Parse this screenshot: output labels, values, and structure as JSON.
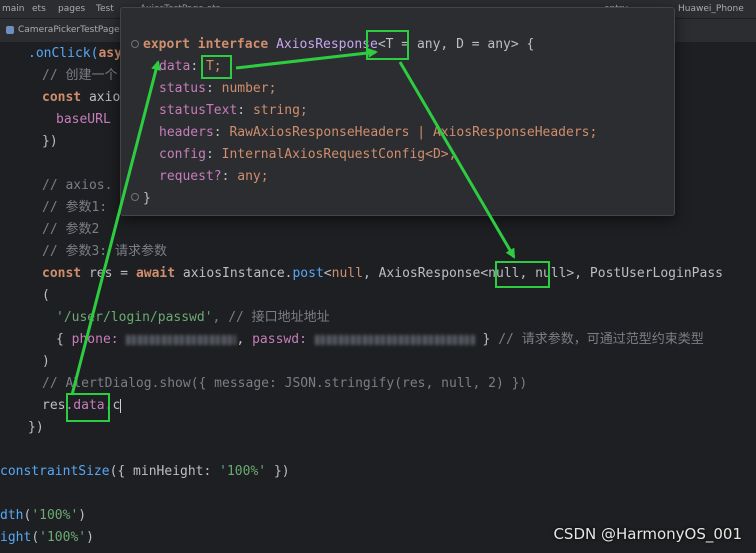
{
  "breadcrumb": {
    "items": [
      "main",
      "ets",
      "pages",
      "Test",
      "AxiosTestPage.ets"
    ],
    "right_items": [
      "entry",
      "Huawei_Phone"
    ]
  },
  "tab": {
    "label": "CameraPickerTestPage"
  },
  "code": {
    "l1_a": ".onClick(",
    "l1_b": "asy",
    "l2": "// 创建一个",
    "l3_a": "const ",
    "l3_b": "axio",
    "l4": "baseURL",
    "l5": "})",
    "l6": "// axios.",
    "l7": "// 参数1:",
    "l8": "// 参数2",
    "l9": "// 参数3: 请求参数",
    "l10_const": "const ",
    "l10_res": "res",
    "l10_eq": " = ",
    "l10_await": "await ",
    "l10_obj": "axiosInstance.",
    "l10_post": "post",
    "l10_lt": "<",
    "l10_null": "null",
    "l10_c1": ", ",
    "l10_ar": "AxiosResponse",
    "l10_gen": "<null, null>",
    "l10_rest": ", PostUserLoginPass",
    "l11": "(",
    "l12_str": "'/user/login/passwd'",
    "l12_cm": ", // 接口地址地址",
    "l13_a": "{ ",
    "l13_phone": "phone: ",
    "l13_b": ", ",
    "l13_pw": "passwd: ",
    "l13_c": " } ",
    "l13_cm": "// 请求参数，可通过范型约束类型",
    "l14": ")",
    "l15": "// AlertDialog.show({ message: JSON.stringify(res, null, 2) })",
    "l16_a": "res",
    "l16_b": ".data",
    "l16_c": ".c",
    "l17": "})",
    "l18_a": "constraintSize",
    "l18_b": "({ minHeight: ",
    "l18_c": "'100%'",
    "l18_d": " })",
    "l19_a": "dth",
    "l19_b": "(",
    "l19_c": "'100%'",
    "l19_d": ")",
    "l20_a": "ight",
    "l20_b": "(",
    "l20_c": "'100%'",
    "l20_d": ")"
  },
  "popup": {
    "p1_kw": "export interface ",
    "p1_name": "AxiosResponse",
    "p1_gen": "<T = any, D = any> {",
    "p2_f": "data",
    "p2_t": "T;",
    "p3_f": "status",
    "p3_t": "number;",
    "p4_f": "statusText",
    "p4_t": "string;",
    "p5_f": "headers",
    "p5_t": "RawAxiosResponseHeaders | AxiosResponseHeaders;",
    "p6_f": "config",
    "p6_t": "InternalAxiosRequestConfig<D>;",
    "p7_f": "request?",
    "p7_t": "any;",
    "p8": "}"
  },
  "watermark": "CSDN @HarmonyOS_001",
  "colors": {
    "highlight": "#2ecc40",
    "background": "#1e1f22"
  }
}
